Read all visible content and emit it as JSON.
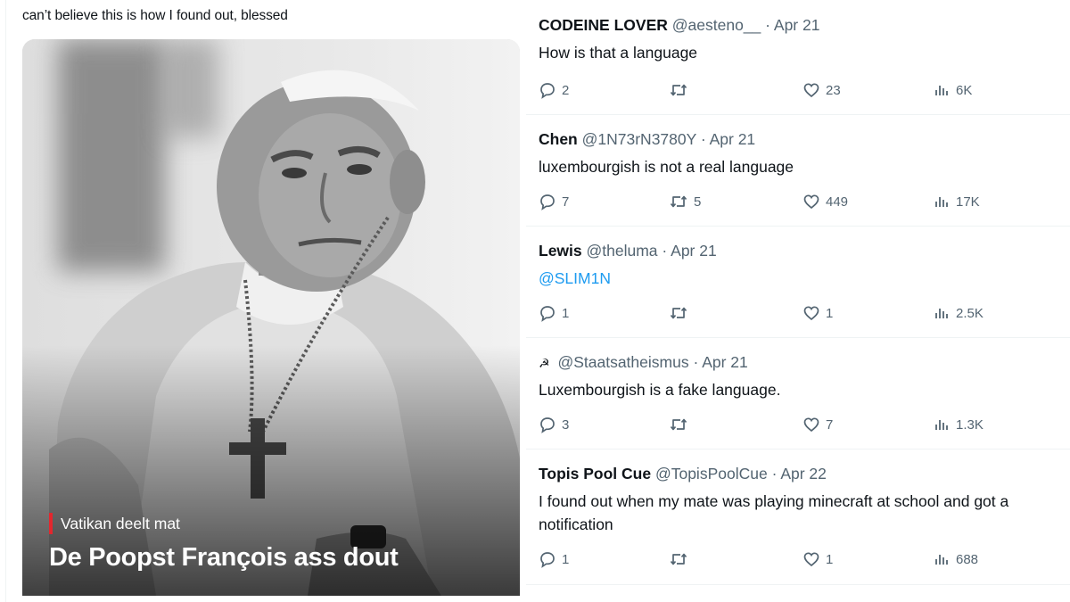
{
  "post": {
    "caption": "can’t believe this is how I found out, blessed",
    "media": {
      "kicker": "Vatikan deelt mat",
      "title": "De Poopst François ass dout",
      "accent_color": "#e3262d"
    }
  },
  "replies": [
    {
      "name": "CODEINE LOVER",
      "handle": "@aesteno__",
      "sep": "·",
      "date": "Apr 21",
      "text": "How is that a language",
      "replies": "2",
      "reposts": "",
      "likes": "23",
      "views": "6K"
    },
    {
      "name": "Chen",
      "handle": "@1N73rN3780Y",
      "sep": "·",
      "date": "Apr 21",
      "text": "luxembourgish is not a real language",
      "replies": "7",
      "reposts": "5",
      "likes": "449",
      "views": "17K"
    },
    {
      "name": "Lewis",
      "handle": "@theluma",
      "sep": "·",
      "date": "Apr 21",
      "text": "@SLIM1N",
      "replies": "1",
      "reposts": "",
      "likes": "1",
      "views": "2.5K"
    },
    {
      "name": "",
      "name_icon": "hammer-sickle-icon",
      "handle": "@Staatsatheismus",
      "sep": "·",
      "date": "Apr 21",
      "text": "Luxembourgish is a fake language.",
      "replies": "3",
      "reposts": "",
      "likes": "7",
      "views": "1.3K"
    },
    {
      "name": "Topis Pool Cue",
      "handle": "@TopisPoolCue",
      "sep": "·",
      "date": "Apr 22",
      "text": "I found out when my mate was playing minecraft at school and got a notification",
      "replies": "1",
      "reposts": "",
      "likes": "1",
      "views": "688"
    }
  ],
  "colors": {
    "text": "#0f1419",
    "secondary": "#536471",
    "link": "#1d9bf0",
    "divider": "#eff3f4"
  },
  "icons": [
    "reply-icon",
    "repost-icon",
    "like-icon",
    "views-icon"
  ]
}
